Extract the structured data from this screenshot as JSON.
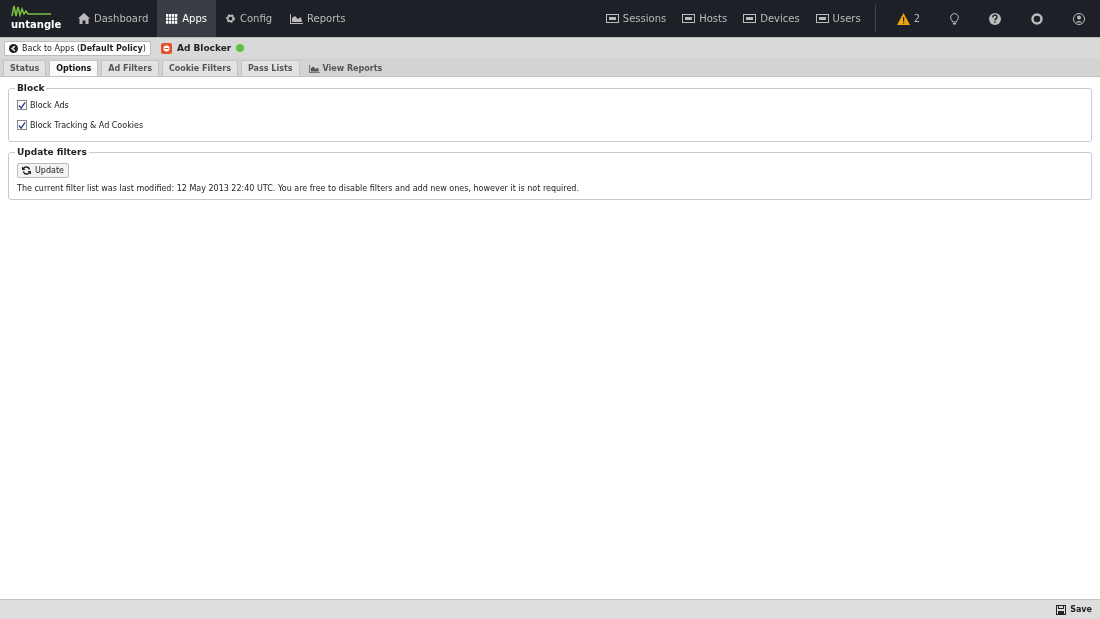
{
  "logo": {
    "text": "untangle"
  },
  "nav": [
    {
      "label": "Dashboard",
      "selected": false
    },
    {
      "label": "Apps",
      "selected": true
    },
    {
      "label": "Config",
      "selected": false
    },
    {
      "label": "Reports",
      "selected": false
    }
  ],
  "nav_right": [
    {
      "label": "Sessions"
    },
    {
      "label": "Hosts"
    },
    {
      "label": "Devices"
    },
    {
      "label": "Users"
    }
  ],
  "alerts": {
    "count": "2"
  },
  "breadcrumb": {
    "back": "Back to Apps (**Default Policy**)",
    "app": "Ad Blocker",
    "running": true
  },
  "tabs": [
    {
      "label": "Status",
      "kind": "tab",
      "selected": false
    },
    {
      "label": "Options",
      "kind": "tab",
      "selected": true
    },
    {
      "label": "Ad Filters",
      "kind": "tab",
      "selected": false
    },
    {
      "label": "Cookie Filters",
      "kind": "tab",
      "selected": false
    },
    {
      "label": "Pass Lists",
      "kind": "tab",
      "selected": false
    },
    {
      "label": "View Reports",
      "kind": "link",
      "selected": false
    }
  ],
  "block": {
    "title": "Block",
    "options": [
      {
        "label": "Block Ads",
        "checked": true
      },
      {
        "label": "Block Tracking & Ad Cookies",
        "checked": true
      }
    ]
  },
  "update": {
    "title": "Update filters",
    "button": "Update",
    "text": "The current filter list was last modified: 12 May 2013 22:40 UTC. You are free to disable filters and add new ones, however it is not required."
  },
  "footer": {
    "save": "Save"
  }
}
